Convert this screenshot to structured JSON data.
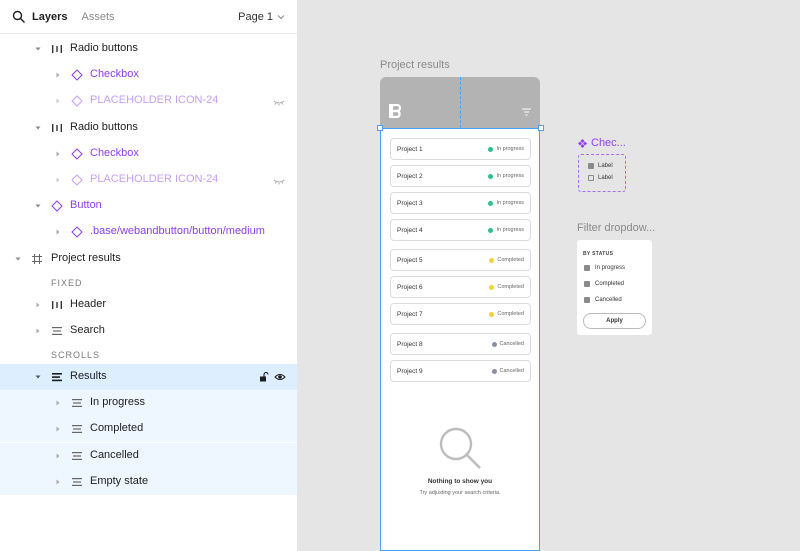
{
  "header": {
    "tabs": [
      {
        "label": "Layers"
      },
      {
        "label": "Assets"
      }
    ],
    "page_label": "Page 1"
  },
  "layers": {
    "radio1": "Radio buttons",
    "checkbox1": "Checkbox",
    "placeholder1": "PLACEHOLDER ICON-24",
    "radio2": "Radio buttons",
    "checkbox2": "Checkbox",
    "placeholder2": "PLACEHOLDER ICON-24",
    "button": "Button",
    "button_base": ".base/webandbutton/button/medium",
    "project_results": "Project results",
    "fixed_section": "FIXED",
    "header": "Header",
    "search": "Search",
    "scrolls_section": "SCROLLS",
    "results": "Results",
    "in_progress": "In progress",
    "completed": "Completed",
    "cancelled": "Cancelled",
    "empty_state": "Empty state"
  },
  "canvas": {
    "frame_title": "Project results",
    "projects": [
      {
        "name": "Project 1",
        "status": "In progress",
        "color": "#2fbf8f"
      },
      {
        "name": "Project 2",
        "status": "In progress",
        "color": "#2fbf8f"
      },
      {
        "name": "Project 3",
        "status": "In progress",
        "color": "#2fbf8f"
      },
      {
        "name": "Project 4",
        "status": "In progress",
        "color": "#2fbf8f"
      },
      {
        "name": "Project 5",
        "status": "Completed",
        "color": "#f2d43a"
      },
      {
        "name": "Project 6",
        "status": "Completed",
        "color": "#f2d43a"
      },
      {
        "name": "Project 7",
        "status": "Completed",
        "color": "#f2d43a"
      },
      {
        "name": "Project 8",
        "status": "Cancelled",
        "color": "#8a8fa8"
      },
      {
        "name": "Project 9",
        "status": "Cancelled",
        "color": "#8a8fa8"
      }
    ],
    "empty_title": "Nothing to show you",
    "empty_sub": "Try adjusting your search criteria.",
    "checkbox_component_label": "Chec...",
    "checkbox_labels": [
      "Label",
      "Label"
    ],
    "filter_label": "Filter dropdow...",
    "filter_heading": "BY STATUS",
    "filter_options": [
      "In progress",
      "Completed",
      "Cancelled"
    ],
    "apply_label": "Apply"
  }
}
